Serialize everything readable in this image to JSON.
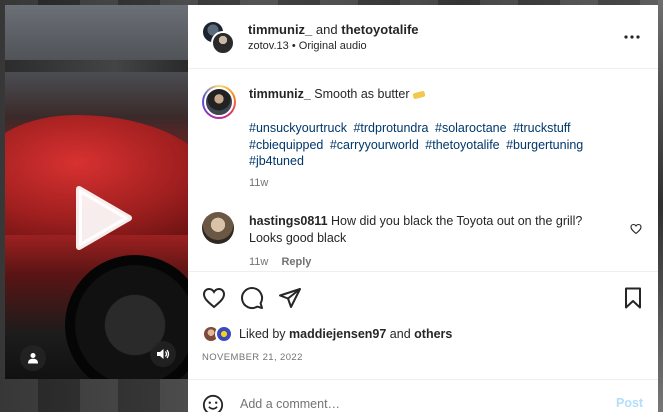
{
  "header": {
    "username": "timmuniz_",
    "connector": "and",
    "collaborator": "thetoyotalife",
    "audio_artist": "zotov.13",
    "audio_separator": "•",
    "audio_label": "Original audio"
  },
  "caption": {
    "username": "timmuniz_",
    "text": "Smooth as butter",
    "emoji": "butter",
    "hashtags": [
      "#unsuckyourtruck",
      "#trdprotundra",
      "#solaroctane",
      "#truckstuff",
      "#cbiequipped",
      "#carryyourworld",
      "#thetoyotalife",
      "#burgertuning",
      "#jb4tuned"
    ],
    "time": "11w"
  },
  "comment": {
    "username": "hastings0811",
    "text": "How did you black the Toyota out on the grill? Looks good black",
    "time": "11w",
    "reply_label": "Reply"
  },
  "likes": {
    "prefix": "Liked by",
    "user": "maddiejensen97",
    "connector": "and",
    "others": "others"
  },
  "post_date": "NOVEMBER 21, 2022",
  "comment_box": {
    "placeholder": "Add a comment…",
    "post_label": "Post"
  },
  "colors": {
    "link": "#00376b",
    "muted": "#737373",
    "post_disabled": "#b2dffc"
  }
}
